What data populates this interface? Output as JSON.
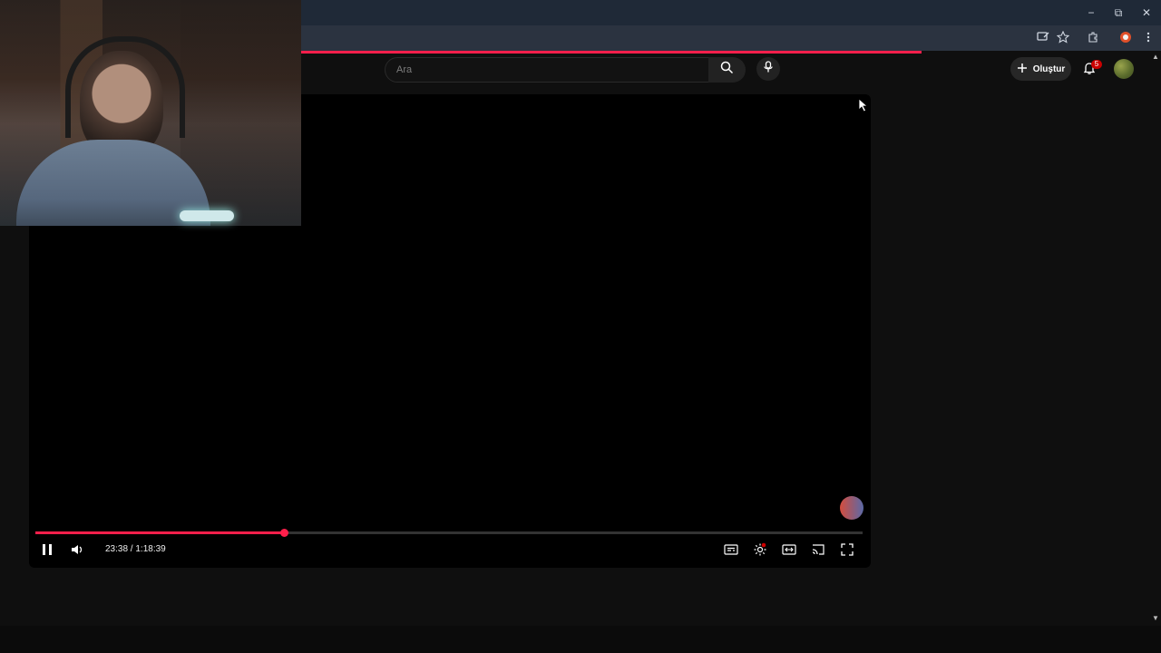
{
  "browser": {
    "window_controls": {
      "minimize": "−",
      "restore": "⧉",
      "close": "✕"
    },
    "toolbar_icons": [
      "install-icon",
      "star-icon",
      "extensions-icon",
      "profile-icon",
      "more-icon"
    ]
  },
  "youtube": {
    "search": {
      "placeholder": "Ara"
    },
    "create_label": "Oluştur",
    "notification_count": "5"
  },
  "player": {
    "time": "23:38 / 1:18:39",
    "progress": 0.301
  }
}
